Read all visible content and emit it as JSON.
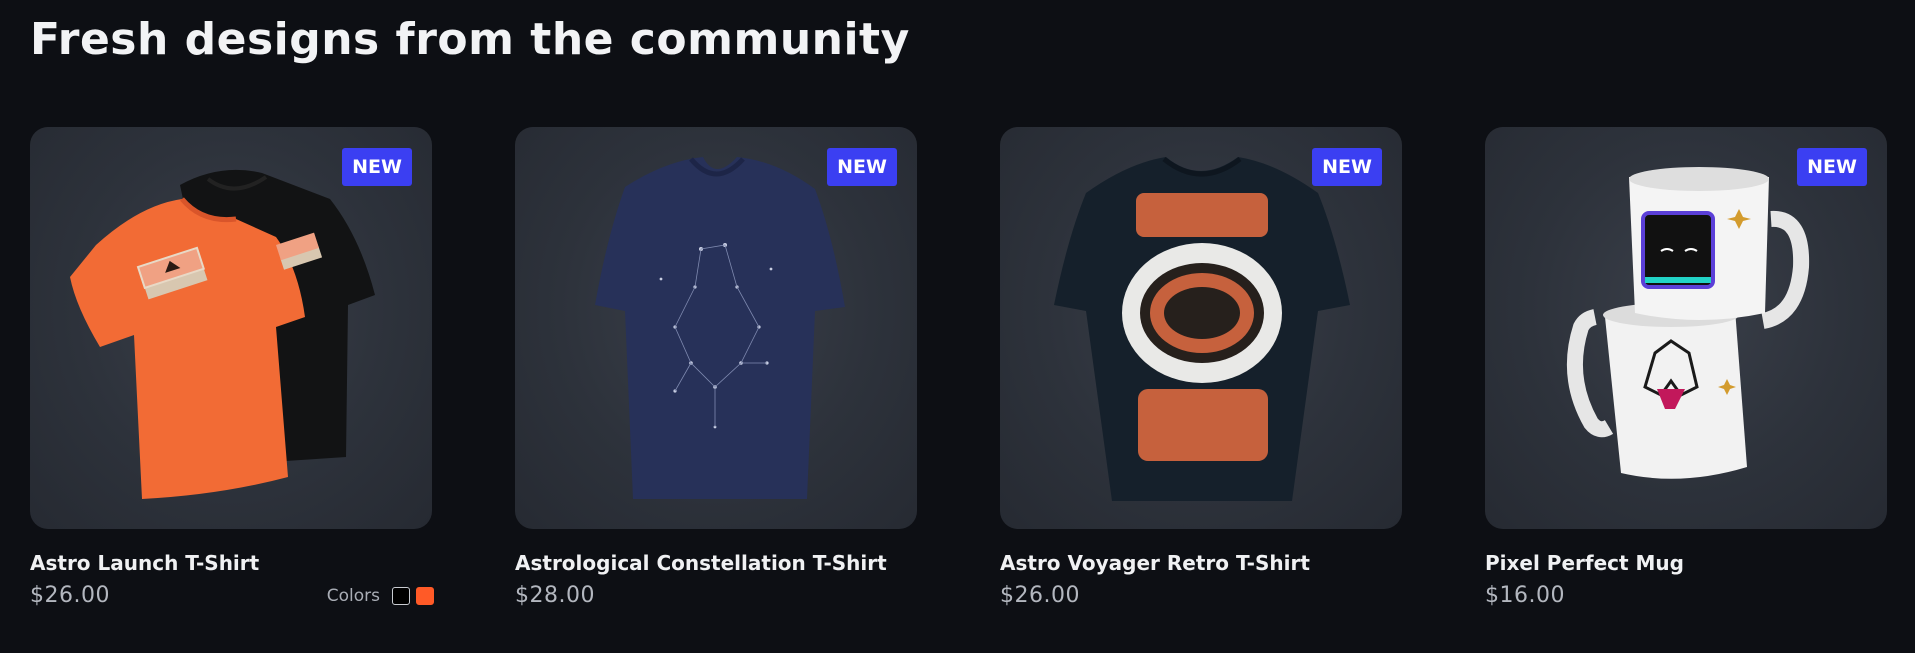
{
  "section_title": "Fresh designs from the community",
  "colors": {
    "background": "#0d0f14",
    "badge": "#3b3ff2",
    "card": "#2d323b"
  },
  "products": [
    {
      "name": "Astro Launch T-Shirt",
      "price": "$26.00",
      "badge": "NEW",
      "colors_label": "Colors",
      "swatches": [
        "#000000",
        "#ff5a27"
      ],
      "image": "orange-and-black-tshirts"
    },
    {
      "name": "Astrological Constellation T-Shirt",
      "price": "$28.00",
      "badge": "NEW",
      "image": "navy-constellation-tshirt"
    },
    {
      "name": "Astro Voyager Retro T-Shirt",
      "price": "$26.00",
      "badge": "NEW",
      "image": "navy-retro-astronaut-tshirt"
    },
    {
      "name": "Pixel Perfect Mug",
      "price": "$16.00",
      "badge": "NEW",
      "image": "stacked-white-mugs"
    }
  ]
}
